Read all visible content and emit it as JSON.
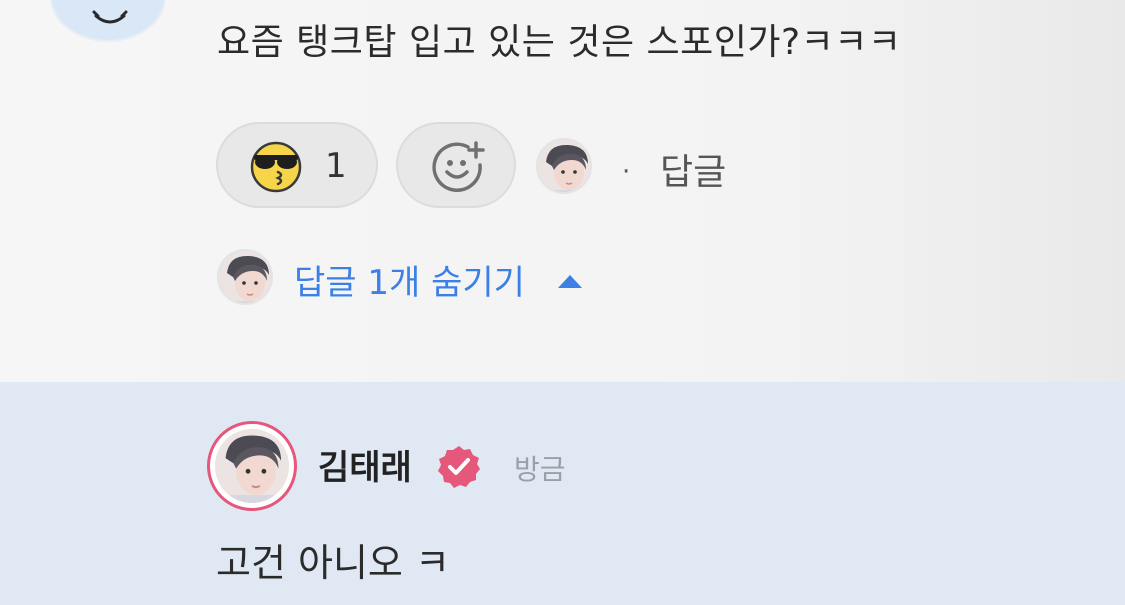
{
  "comment": {
    "text": "요즘 탱크탑 입고 있는 것은 스포인가?ㅋㅋㅋ",
    "reactions": [
      {
        "icon": "sunglasses-kiss-emoji-icon",
        "count": "1"
      }
    ],
    "add_reaction_icon": "add-reaction-smile-icon",
    "separator": "·",
    "reply_label": "답글",
    "toggle_replies_label": "답글 1개 숨기기",
    "toggle_icon": "caret-up-icon"
  },
  "reply": {
    "author": "김태래",
    "verified_icon": "verified-badge-icon",
    "time": "방금",
    "text": "고건 아니오 ㅋ"
  },
  "colors": {
    "link_blue": "#3c80e5",
    "verified_pink": "#e5577b",
    "reply_background": "#e0e9f3"
  }
}
